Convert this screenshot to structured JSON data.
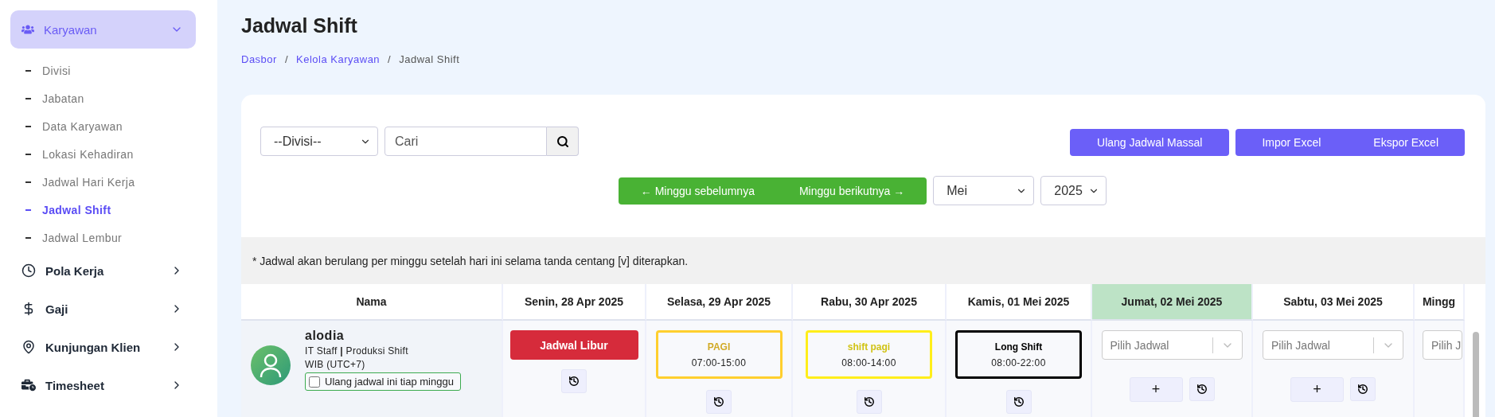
{
  "sidebar": {
    "items": [
      {
        "label": "Karyawan",
        "expanded": true,
        "children": [
          {
            "label": "Divisi",
            "selected": false
          },
          {
            "label": "Jabatan",
            "selected": false
          },
          {
            "label": "Data Karyawan",
            "selected": false
          },
          {
            "label": "Lokasi Kehadiran",
            "selected": false
          },
          {
            "label": "Jadwal Hari Kerja",
            "selected": false
          },
          {
            "label": "Jadwal Shift",
            "selected": true
          },
          {
            "label": "Jadwal Lembur",
            "selected": false
          }
        ]
      },
      {
        "label": "Pola Kerja",
        "expanded": false
      },
      {
        "label": "Gaji",
        "expanded": false
      },
      {
        "label": "Kunjungan Klien",
        "expanded": false
      },
      {
        "label": "Timesheet",
        "expanded": false
      }
    ]
  },
  "page_title": "Jadwal Shift",
  "breadcrumb": [
    {
      "label": "Dasbor",
      "kind": "link"
    },
    {
      "label": "/",
      "kind": "separator"
    },
    {
      "label": "Kelola Karyawan",
      "kind": "link"
    },
    {
      "label": "/",
      "kind": "separator"
    },
    {
      "label": "Jadwal Shift",
      "kind": "current"
    }
  ],
  "filters": {
    "division": "--Divisi--",
    "search": {
      "placeholder": "Cari"
    }
  },
  "actions": [
    {
      "labels": [
        "Ulang Jadwal Massal"
      ]
    },
    {
      "labels": [
        "Impor Excel",
        "Ekspor Excel"
      ]
    }
  ],
  "week_nav": {
    "previous": "← Minggu sebelumnya",
    "next": "Minggu berikutnya →"
  },
  "month": "Mei",
  "year": "2025",
  "note": "* Jadwal akan berulang per minggu setelah hari ini selama tanda centang [v] diterapkan.",
  "table": {
    "columns": [
      {
        "label": "Nama",
        "today": false
      },
      {
        "label": "Senin, 28 Apr 2025",
        "today": false
      },
      {
        "label": "Selasa, 29 Apr 2025",
        "today": false
      },
      {
        "label": "Rabu, 30 Apr 2025",
        "today": false
      },
      {
        "label": "Kamis, 01 Mei 2025",
        "today": false
      },
      {
        "label": "Jumat, 02 Mei 2025",
        "today": true
      },
      {
        "label": "Sabtu, 03 Mei 2025",
        "today": false
      },
      {
        "label": "Mingg",
        "today": false
      }
    ],
    "rows": [
      {
        "cells": [
          {
            "kind": "employee",
            "name": "alodia",
            "role": "IT Staff **|** Produksi Shift",
            "timezone": "WIB (UTC+7)",
            "repeat": {
              "label": "Ulang jadwal ini tiap minggu",
              "checked": false
            }
          },
          {
            "kind": "off",
            "label": "Jadwal Libur"
          },
          {
            "kind": "shift",
            "name": "PAGI",
            "time": "07:00-15:00",
            "color": "#ffcf2e"
          },
          {
            "kind": "shift",
            "name": "shift pagi",
            "time": "08:00-14:00",
            "color": "#ffee1a"
          },
          {
            "kind": "shift",
            "name": "Long Shift",
            "time": "08:00-22:00",
            "color": "#000000"
          },
          {
            "kind": "empty",
            "placeholder": "Pilih Jadwal",
            "add_label": "+"
          },
          {
            "kind": "empty",
            "placeholder": "Pilih Jadwal",
            "add_label": "+"
          },
          {
            "kind": "empty",
            "placeholder": "Pilih J"
          }
        ]
      }
    ]
  }
}
